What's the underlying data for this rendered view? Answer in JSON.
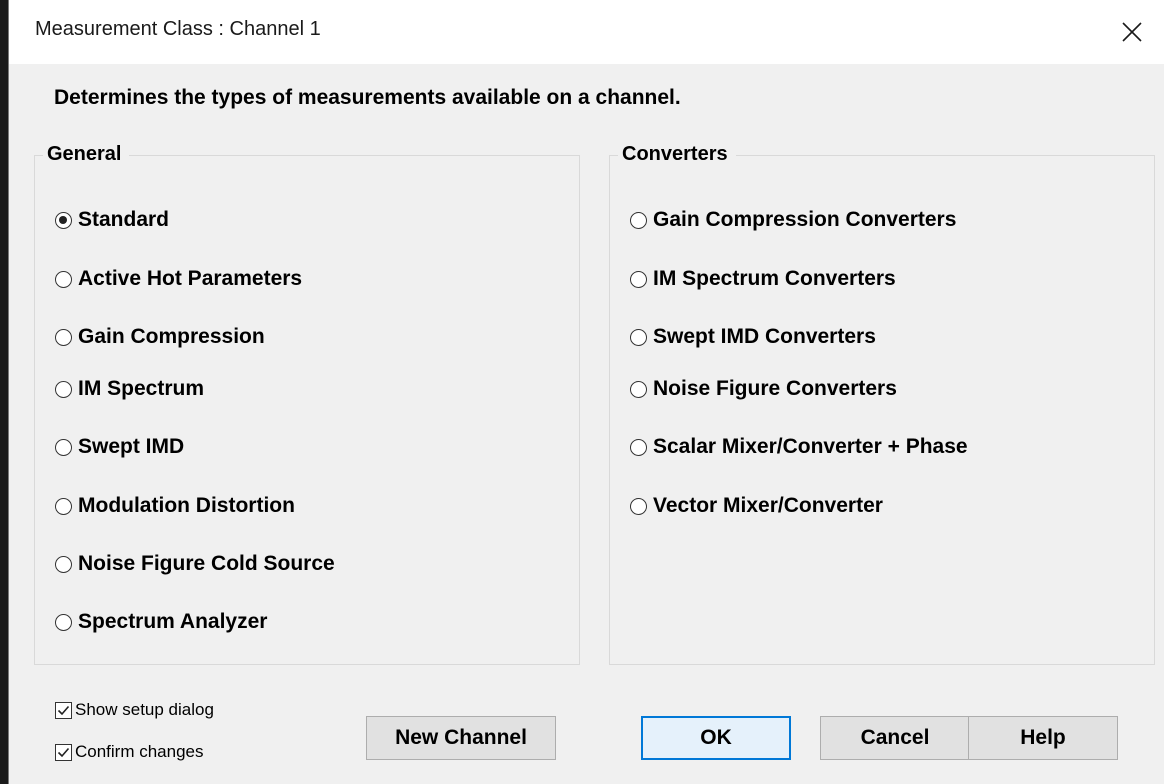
{
  "window": {
    "title": "Measurement Class : Channel 1",
    "close_symbol": "✕"
  },
  "description": "Determines the types of measurements available on a channel.",
  "general": {
    "label": "General",
    "options": [
      {
        "label": "Standard",
        "checked": true
      },
      {
        "label": "Active Hot Parameters",
        "checked": false
      },
      {
        "label": "Gain Compression",
        "checked": false
      },
      {
        "label": "IM Spectrum",
        "checked": false
      },
      {
        "label": "Swept IMD",
        "checked": false
      },
      {
        "label": "Modulation Distortion",
        "checked": false
      },
      {
        "label": "Noise Figure Cold Source",
        "checked": false
      },
      {
        "label": "Spectrum Analyzer",
        "checked": false
      }
    ]
  },
  "converters": {
    "label": "Converters",
    "options": [
      {
        "label": "Gain Compression Converters",
        "checked": false
      },
      {
        "label": "IM Spectrum Converters",
        "checked": false
      },
      {
        "label": "Swept IMD Converters",
        "checked": false
      },
      {
        "label": "Noise Figure Converters",
        "checked": false
      },
      {
        "label": "Scalar Mixer/Converter + Phase",
        "checked": false
      },
      {
        "label": "Vector Mixer/Converter",
        "checked": false
      }
    ]
  },
  "checkboxes": {
    "show_setup": {
      "label": "Show setup dialog",
      "checked": true
    },
    "confirm_changes": {
      "label": "Confirm changes",
      "checked": true
    }
  },
  "buttons": {
    "new_channel": "New Channel",
    "ok": "OK",
    "cancel": "Cancel",
    "help": "Help"
  },
  "colors": {
    "dialog_bg": "#f0f0f0",
    "default_button_border": "#0078d7"
  }
}
